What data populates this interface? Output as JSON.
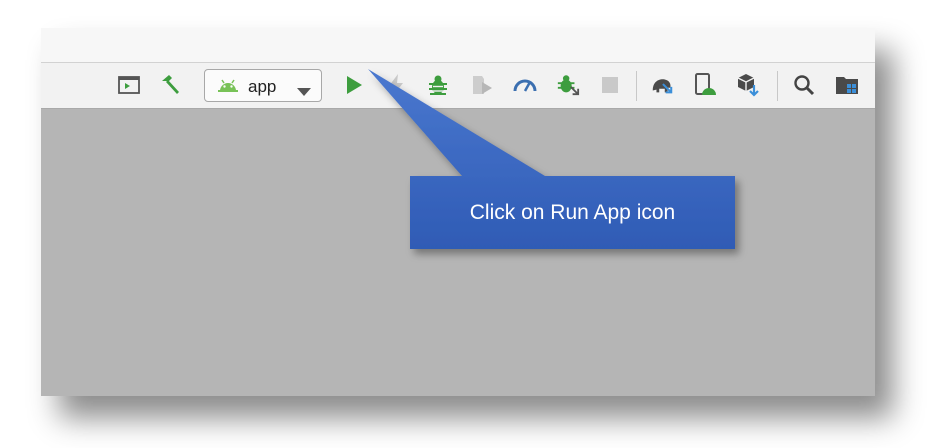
{
  "toolbar": {
    "config": {
      "value": "app"
    },
    "icons": [
      {
        "name": "select-run-debug-icon"
      },
      {
        "name": "make-project-hammer-icon"
      },
      {
        "name": "run-app-icon"
      },
      {
        "name": "apply-changes-icon"
      },
      {
        "name": "debug-icon"
      },
      {
        "name": "run-with-coverage-icon"
      },
      {
        "name": "profile-icon"
      },
      {
        "name": "attach-debugger-icon"
      },
      {
        "name": "stop-icon"
      },
      {
        "name": "gradle-sync-icon"
      },
      {
        "name": "avd-manager-icon"
      },
      {
        "name": "sdk-manager-icon"
      },
      {
        "name": "search-icon"
      },
      {
        "name": "project-structure-icon"
      }
    ]
  },
  "callout": {
    "text": "Click on Run App icon",
    "fill": "#3a67c4"
  },
  "colors": {
    "green": "#3d9d3e",
    "gray_icon": "#6b6b6b",
    "disabled": "#c3c3c3",
    "blue_accent": "#3b8fd9"
  }
}
